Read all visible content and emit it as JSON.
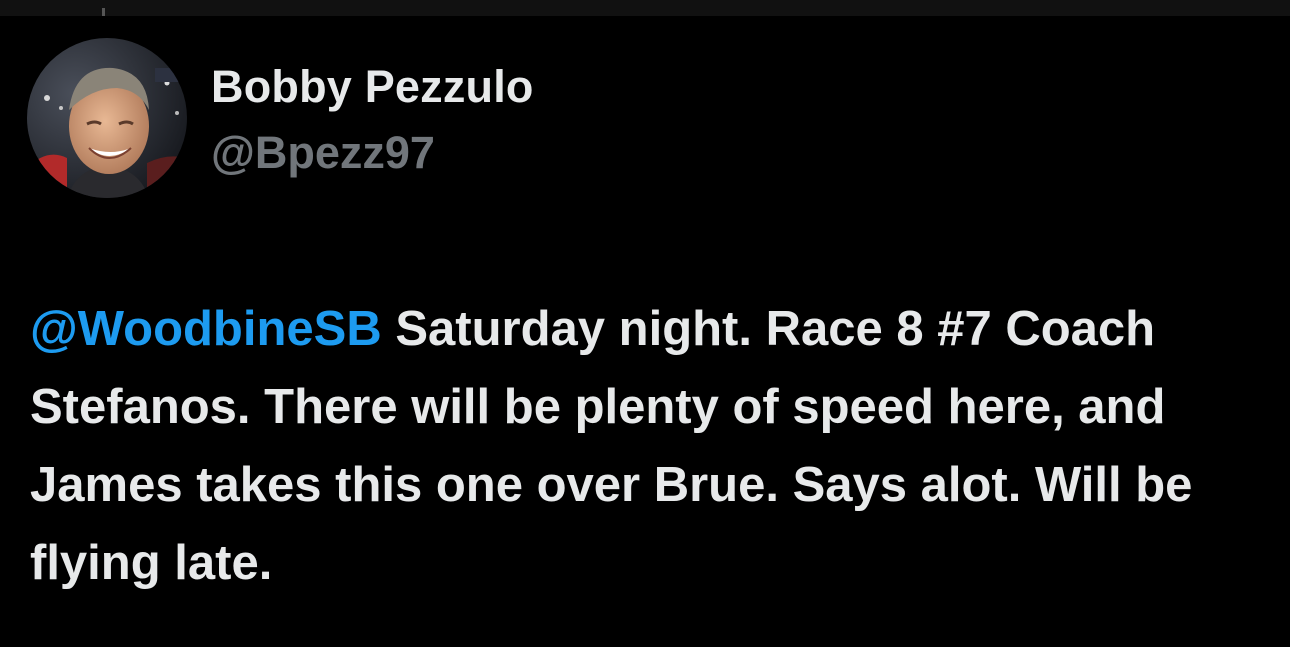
{
  "author": {
    "display_name": "Bobby Pezzulo",
    "handle": "@Bpezz97"
  },
  "tweet": {
    "mention": "@WoodbineSB",
    "text": " Saturday night. Race 8 #7 Coach Stefanos. There will be plenty of speed here, and James takes this one over Brue. Says alot. Will be flying late."
  },
  "colors": {
    "background": "#000000",
    "primary_text": "#e7e9ea",
    "secondary_text": "#71767b",
    "mention": "#1d9bf0"
  }
}
